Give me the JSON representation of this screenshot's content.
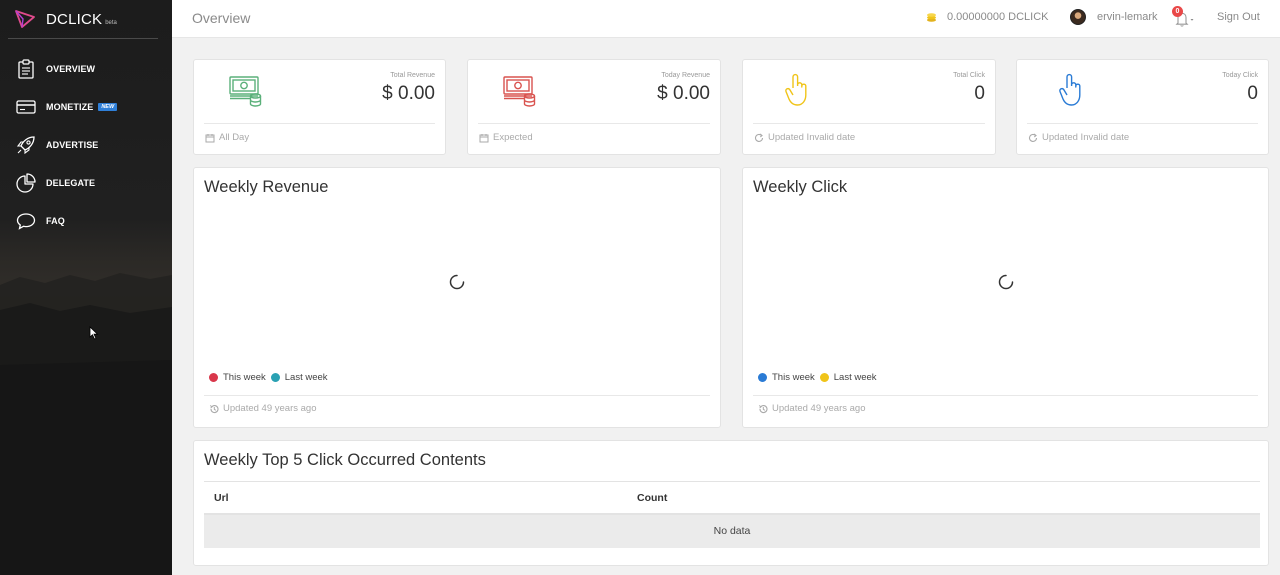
{
  "brand": {
    "name": "DCLICK",
    "beta": "beta"
  },
  "sidebar": {
    "items": [
      {
        "label": "OVERVIEW",
        "icon": "clipboard-icon"
      },
      {
        "label": "MONETIZE",
        "icon": "card-icon",
        "badge": "NEW"
      },
      {
        "label": "ADVERTISE",
        "icon": "rocket-icon"
      },
      {
        "label": "DELEGATE",
        "icon": "pie-chart-icon"
      },
      {
        "label": "FAQ",
        "icon": "speech-bubble-icon"
      }
    ]
  },
  "topbar": {
    "title": "Overview",
    "balance": "0.00000000 DCLICK",
    "username": "ervin-lemark",
    "notifications": "0",
    "sign_out": "Sign Out"
  },
  "stats": [
    {
      "label": "Total Revenue",
      "value": "$ 0.00",
      "footer": "All Day",
      "icon": "money-stack-icon",
      "icon_color": "#5bb07a",
      "footer_icon": "calendar-icon"
    },
    {
      "label": "Today Revenue",
      "value": "$ 0.00",
      "footer": "Expected",
      "icon": "money-stack-icon",
      "icon_color": "#d9534f",
      "footer_icon": "calendar-icon"
    },
    {
      "label": "Total Click",
      "value": "0",
      "footer": "Updated Invalid date",
      "icon": "hand-pointer-icon",
      "icon_color": "#f0c419",
      "footer_icon": "refresh-icon"
    },
    {
      "label": "Today Click",
      "value": "0",
      "footer": "Updated Invalid date",
      "icon": "hand-pointer-icon",
      "icon_color": "#2a7bd5",
      "footer_icon": "refresh-icon"
    }
  ],
  "charts": [
    {
      "title": "Weekly Revenue",
      "legend": [
        {
          "label": "This week",
          "color": "#d9374b"
        },
        {
          "label": "Last week",
          "color": "#2aa1b3"
        }
      ],
      "footer": "Updated 49 years ago"
    },
    {
      "title": "Weekly Click",
      "legend": [
        {
          "label": "This week",
          "color": "#2a7bd5"
        },
        {
          "label": "Last week",
          "color": "#f0c419"
        }
      ],
      "footer": "Updated 49 years ago"
    }
  ],
  "top5": {
    "title": "Weekly Top 5 Click Occurred Contents",
    "columns": [
      "Url",
      "Count"
    ],
    "empty": "No data"
  }
}
